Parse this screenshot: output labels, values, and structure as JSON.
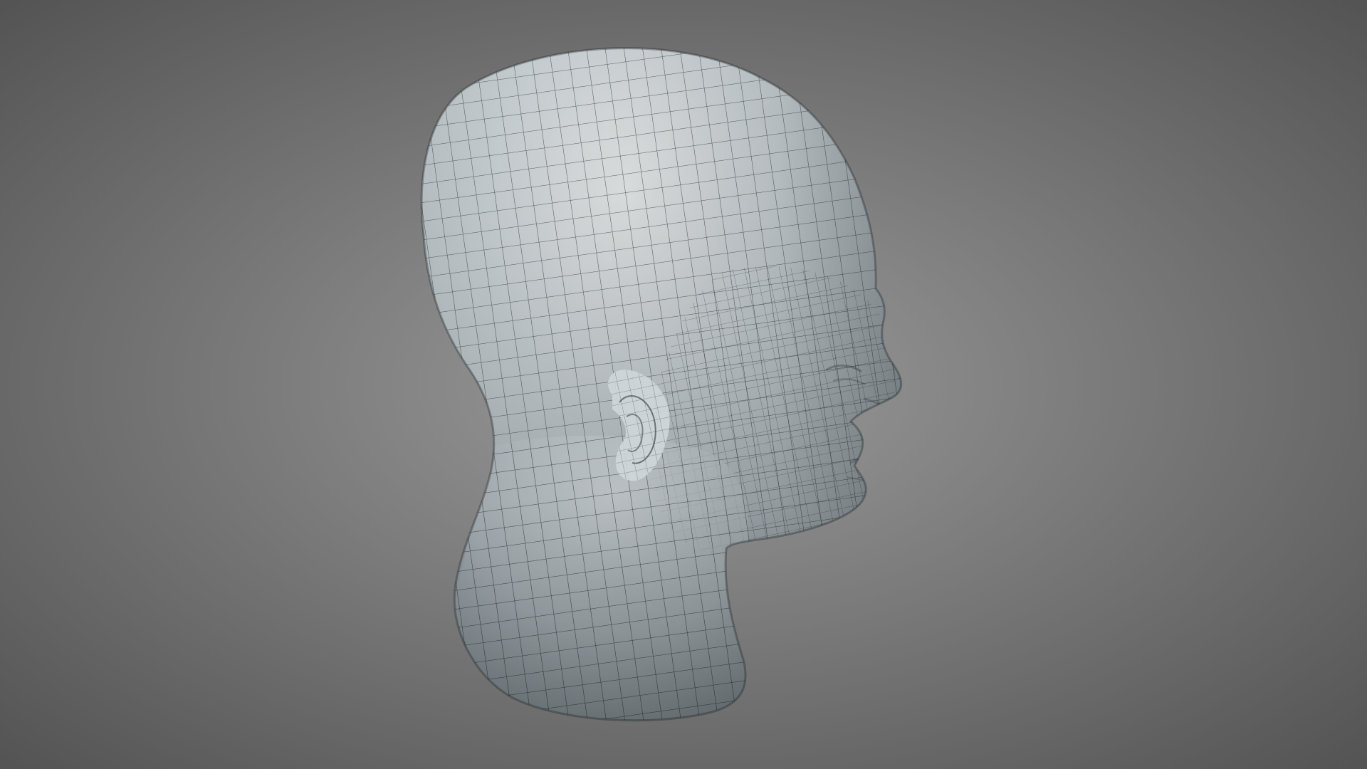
{
  "scene": {
    "subject": "head-mesh",
    "colors": {
      "background_center": "#9a9a9a",
      "background_edge": "#4f4f4f",
      "mesh_surface_light": "#e6e9ea",
      "mesh_surface_mid": "#b9c2c6",
      "mesh_surface_dark": "#7f8b91",
      "wire_color": "#1b1f22"
    }
  }
}
